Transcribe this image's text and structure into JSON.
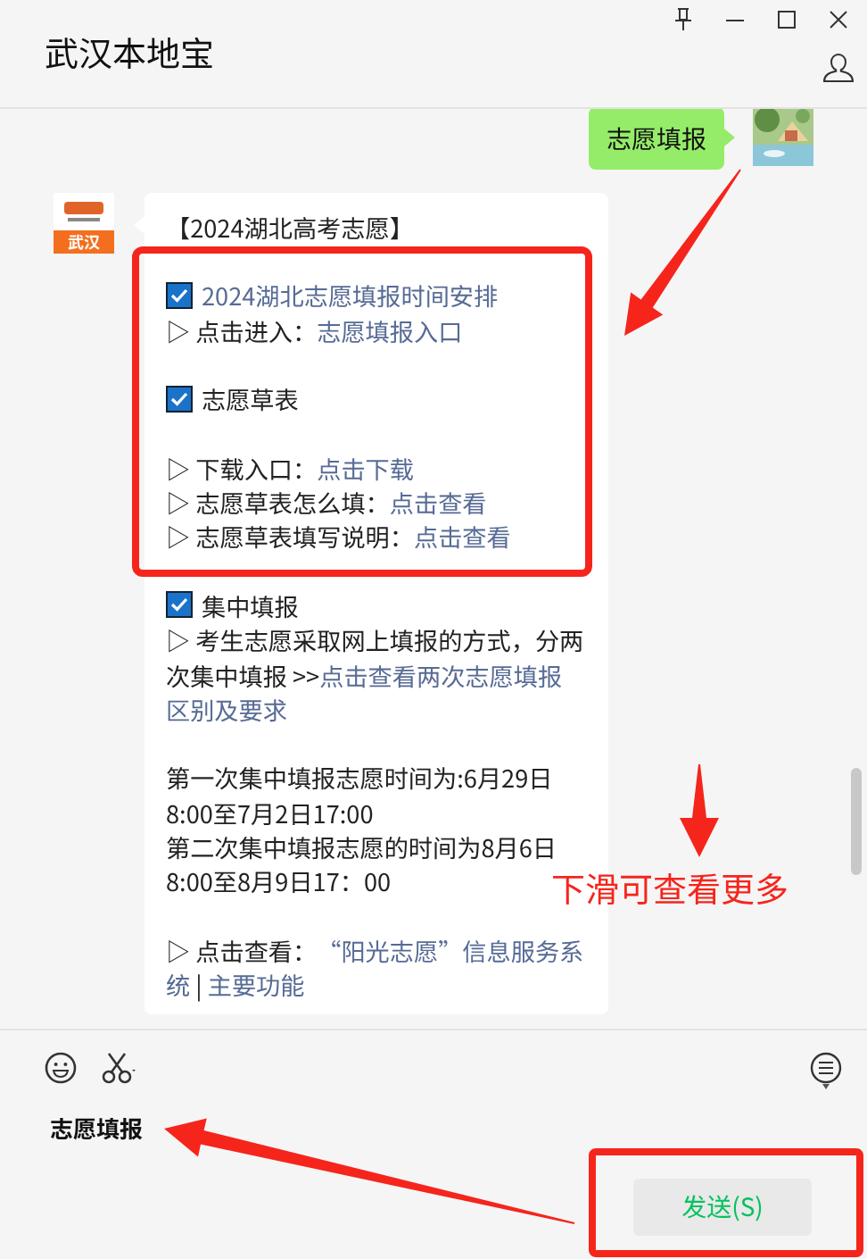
{
  "window": {
    "title": "武汉本地宝"
  },
  "messages": [
    {
      "kind": "outgoing",
      "text": "志愿填报"
    },
    {
      "kind": "incoming",
      "avatar_label": "武汉",
      "lines": [
        {
          "kind": "text",
          "segments": [
            {
              "text": "【2024湖北高考志愿】",
              "link": false
            }
          ]
        },
        {
          "kind": "blank"
        },
        {
          "kind": "text",
          "segments": [
            {
              "kind": "checkbox"
            },
            {
              "text": "2024湖北志愿填报时间安排",
              "link": true
            }
          ]
        },
        {
          "kind": "text",
          "segments": [
            {
              "text": "▷ 点击进入：",
              "link": false
            },
            {
              "text": "志愿填报入口",
              "link": true
            }
          ]
        },
        {
          "kind": "blank"
        },
        {
          "kind": "text",
          "segments": [
            {
              "kind": "checkbox"
            },
            {
              "text": "志愿草表",
              "link": false
            }
          ]
        },
        {
          "kind": "blank"
        },
        {
          "kind": "text",
          "segments": [
            {
              "text": "▷ 下载入口：",
              "link": false
            },
            {
              "text": "点击下载",
              "link": true
            }
          ]
        },
        {
          "kind": "text",
          "segments": [
            {
              "text": "▷ 志愿草表怎么填：",
              "link": false
            },
            {
              "text": "点击查看",
              "link": true
            }
          ]
        },
        {
          "kind": "text",
          "segments": [
            {
              "text": "▷ 志愿草表填写说明：",
              "link": false
            },
            {
              "text": "点击查看",
              "link": true
            }
          ]
        },
        {
          "kind": "blank"
        },
        {
          "kind": "text",
          "segments": [
            {
              "kind": "checkbox"
            },
            {
              "text": "集中填报",
              "link": false
            }
          ]
        },
        {
          "kind": "text",
          "segments": [
            {
              "text": "▷ 考生志愿采取网上填报的方式，分两",
              "link": false
            }
          ]
        },
        {
          "kind": "text",
          "segments": [
            {
              "text": "次集中填报 >>",
              "link": false
            },
            {
              "text": "点击查看两次志愿填报",
              "link": true
            }
          ]
        },
        {
          "kind": "text",
          "segments": [
            {
              "text": "区别及要求",
              "link": true
            }
          ]
        },
        {
          "kind": "blank"
        },
        {
          "kind": "text",
          "segments": [
            {
              "text": "第一次集中填报志愿时间为:6月29日",
              "link": false
            }
          ]
        },
        {
          "kind": "text",
          "segments": [
            {
              "text": "8:00至7月2日17:00",
              "link": false
            }
          ]
        },
        {
          "kind": "text",
          "segments": [
            {
              "text": "第二次集中填报志愿的时间为8月6日",
              "link": false
            }
          ]
        },
        {
          "kind": "text",
          "segments": [
            {
              "text": "8:00至8月9日17：00",
              "link": false
            }
          ]
        },
        {
          "kind": "blank"
        },
        {
          "kind": "text",
          "segments": [
            {
              "text": "▷ 点击查看：",
              "link": false
            },
            {
              "text": "“阳光志愿”信息服务系",
              "link": true
            }
          ]
        },
        {
          "kind": "text",
          "segments": [
            {
              "text": "统",
              "link": true
            },
            {
              "text": " | ",
              "link": false
            },
            {
              "text": "主要功能",
              "link": true
            }
          ]
        }
      ]
    }
  ],
  "composer": {
    "value": "志愿填报",
    "send_button": "发送(S)"
  },
  "annotation": {
    "text": "下滑可查看更多"
  }
}
